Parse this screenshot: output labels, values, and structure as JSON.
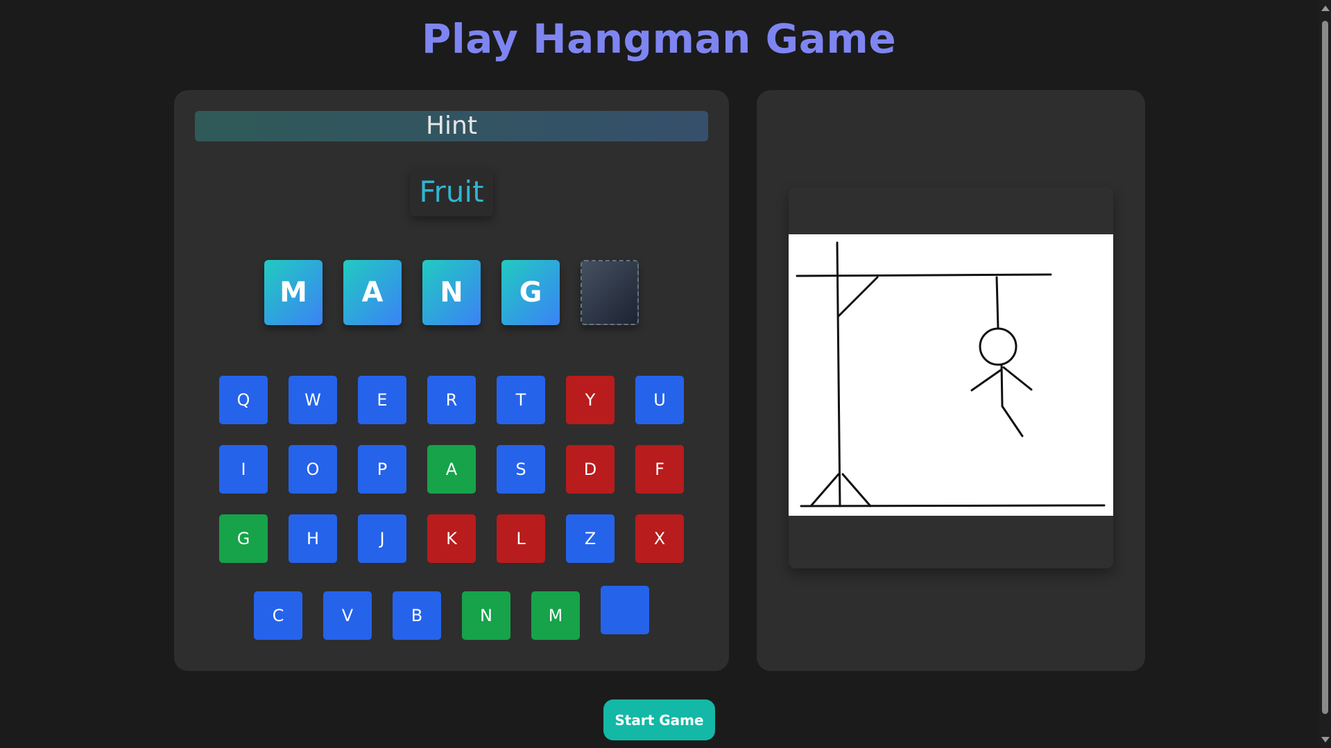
{
  "title": "Play Hangman Game",
  "hint": {
    "label": "Hint",
    "value": "Fruit"
  },
  "word": {
    "letters": [
      "M",
      "A",
      "N",
      "G",
      ""
    ]
  },
  "keyboard": {
    "rows": [
      [
        {
          "letter": "Q",
          "state": "neutral"
        },
        {
          "letter": "W",
          "state": "neutral"
        },
        {
          "letter": "E",
          "state": "neutral"
        },
        {
          "letter": "R",
          "state": "neutral"
        },
        {
          "letter": "T",
          "state": "neutral"
        },
        {
          "letter": "Y",
          "state": "wrong"
        },
        {
          "letter": "U",
          "state": "neutral"
        }
      ],
      [
        {
          "letter": "I",
          "state": "neutral"
        },
        {
          "letter": "O",
          "state": "neutral"
        },
        {
          "letter": "P",
          "state": "neutral"
        },
        {
          "letter": "A",
          "state": "correct"
        },
        {
          "letter": "S",
          "state": "neutral"
        },
        {
          "letter": "D",
          "state": "wrong"
        },
        {
          "letter": "F",
          "state": "wrong"
        }
      ],
      [
        {
          "letter": "G",
          "state": "correct"
        },
        {
          "letter": "H",
          "state": "neutral"
        },
        {
          "letter": "J",
          "state": "neutral"
        },
        {
          "letter": "K",
          "state": "wrong"
        },
        {
          "letter": "L",
          "state": "wrong"
        },
        {
          "letter": "Z",
          "state": "neutral"
        },
        {
          "letter": "X",
          "state": "wrong"
        }
      ],
      [
        {
          "letter": "C",
          "state": "neutral"
        },
        {
          "letter": "V",
          "state": "neutral"
        },
        {
          "letter": "B",
          "state": "neutral"
        },
        {
          "letter": "N",
          "state": "correct"
        },
        {
          "letter": "M",
          "state": "correct"
        },
        {
          "letter": "",
          "state": "neutral"
        }
      ]
    ]
  },
  "colors": {
    "title": "#7e85f1",
    "neutral_key": "#2563eb",
    "correct_key": "#16a34a",
    "wrong_key": "#b91c1c",
    "start_button": "#14b8a6"
  },
  "start_button": {
    "label": "Start Game"
  }
}
